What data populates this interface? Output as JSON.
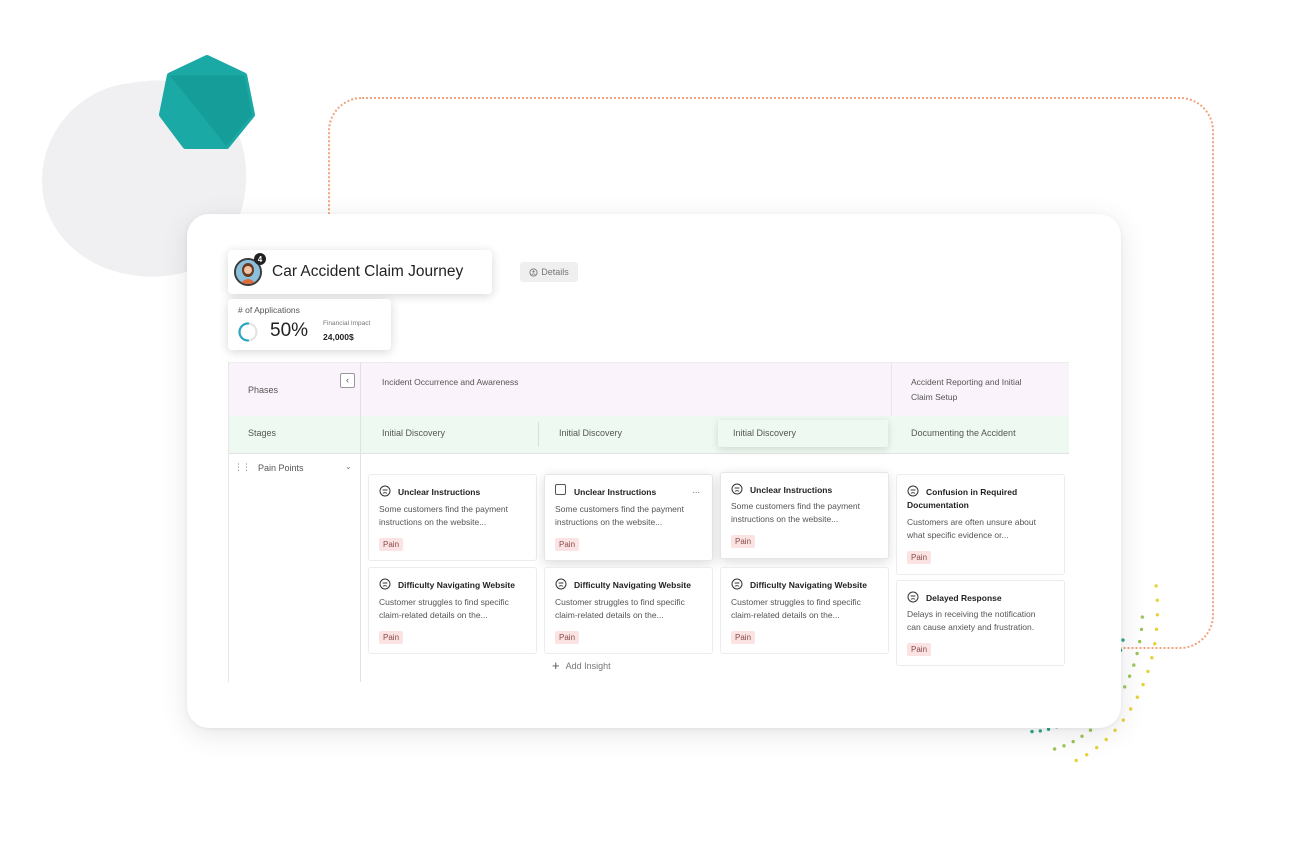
{
  "header": {
    "title": "Car Accident Claim Journey",
    "badge_count": "4",
    "details_label": "Details"
  },
  "metrics": {
    "label": "# of Applications",
    "percent_text": "50%",
    "percent_value": 0.5,
    "financial_label": "Financial Impact",
    "financial_value": "24,000$"
  },
  "board": {
    "phases_label": "Phases",
    "stages_label": "Stages",
    "pain_points_label": "Pain Points",
    "phases": [
      "Incident Occurrence and Awareness",
      "Accident Reporting and Initial Claim Setup"
    ],
    "stages": [
      "Initial Discovery",
      "Initial Discovery",
      "Initial Discovery",
      "Documenting the Accident"
    ],
    "add_insight_label": "Add Insight",
    "cards": [
      {
        "title": "Unclear Instructions",
        "desc1": "Some customers find the payment",
        "desc2": "instructions on the website...",
        "tag": "Pain"
      },
      {
        "title": "Difficulty Navigating Website",
        "desc1": "Customer struggles to find specific",
        "desc2": "claim-related details on the...",
        "tag": "Pain"
      },
      {
        "title": "Unclear Instructions",
        "desc1": "Some customers find the payment",
        "desc2": "instructions on the website...",
        "tag": "Pain",
        "more": "..."
      },
      {
        "title": "Difficulty Navigating Website",
        "desc1": "Customer struggles to find specific",
        "desc2": "claim-related details on the...",
        "tag": "Pain"
      },
      {
        "title": "Unclear Instructions",
        "desc1": "Some customers find the payment",
        "desc2": "instructions on the website...",
        "tag": "Pain"
      },
      {
        "title": "Difficulty Navigating Website",
        "desc1": "Customer struggles to find specific",
        "desc2": "claim-related details on the...",
        "tag": "Pain"
      },
      {
        "title1": "Confusion in Required",
        "title2": "Documentation",
        "desc1": "Customers are often unsure about",
        "desc2": "what specific evidence or...",
        "tag": "Pain"
      },
      {
        "title": "Delayed Response",
        "desc1": "Delays in receiving the notification",
        "desc2": "can cause anxiety and frustration.",
        "tag": "Pain"
      }
    ]
  },
  "colors": {
    "accent_teal": "#1aa9a5",
    "phases_bg": "#fbf3fb",
    "stages_bg": "#eefaf1",
    "pain_tag_bg": "#fbe3e3"
  }
}
